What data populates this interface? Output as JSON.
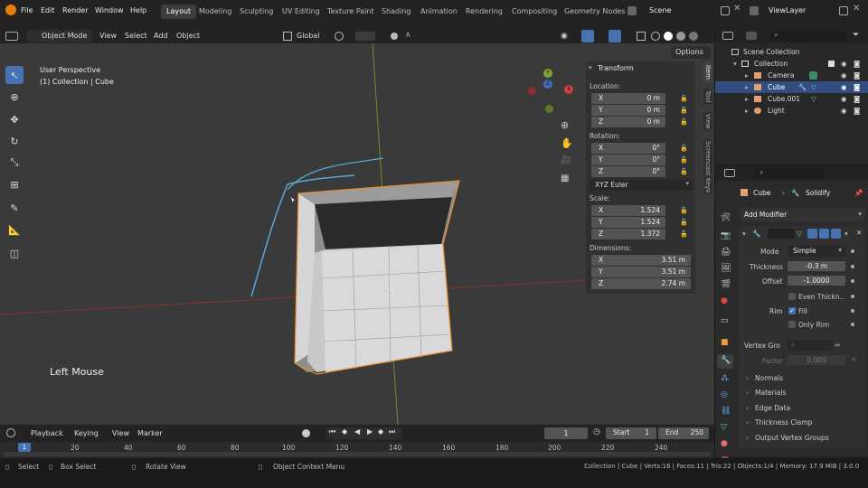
{
  "topbar": {
    "menus": [
      "File",
      "Edit",
      "Render",
      "Window",
      "Help"
    ],
    "workspaces": [
      "Layout",
      "Modeling",
      "Sculpting",
      "UV Editing",
      "Texture Paint",
      "Shading",
      "Animation",
      "Rendering",
      "Compositing",
      "Geometry Nodes"
    ],
    "active_workspace": "Layout",
    "scene_label": "Scene",
    "viewlayer_label": "ViewLayer"
  },
  "viewport_header": {
    "mode": "Object Mode",
    "menus": [
      "View",
      "Select",
      "Add",
      "Object"
    ],
    "orientation": "Global",
    "options_label": "Options"
  },
  "viewport": {
    "perspective": "User Perspective",
    "collection_info": "(1) Collection | Cube",
    "input_hint": "Left Mouse",
    "gizmo_axes": [
      "Y",
      "Z",
      "X"
    ]
  },
  "npanel": {
    "title": "Transform",
    "location_label": "Location:",
    "location": [
      {
        "axis": "X",
        "value": "0 m"
      },
      {
        "axis": "Y",
        "value": "0 m"
      },
      {
        "axis": "Z",
        "value": "0 m"
      }
    ],
    "rotation_label": "Rotation:",
    "rotation": [
      {
        "axis": "X",
        "value": "0°"
      },
      {
        "axis": "Y",
        "value": "0°"
      },
      {
        "axis": "Z",
        "value": "0°"
      }
    ],
    "rotation_mode": "XYZ Euler",
    "scale_label": "Scale:",
    "scale": [
      {
        "axis": "X",
        "value": "1.524"
      },
      {
        "axis": "Y",
        "value": "1.524"
      },
      {
        "axis": "Z",
        "value": "1.372"
      }
    ],
    "dimensions_label": "Dimensions:",
    "dimensions": [
      {
        "axis": "X",
        "value": "3.51 m"
      },
      {
        "axis": "Y",
        "value": "3.51 m"
      },
      {
        "axis": "Z",
        "value": "2.74 m"
      }
    ],
    "tabs": [
      "Item",
      "Tool",
      "View",
      "Screencast Keys"
    ]
  },
  "outliner": {
    "rows": [
      {
        "label": "Scene Collection"
      },
      {
        "label": "Collection"
      },
      {
        "label": "Camera"
      },
      {
        "label": "Cube"
      },
      {
        "label": "Cube.001"
      },
      {
        "label": "Light"
      }
    ]
  },
  "properties": {
    "object_name": "Cube",
    "modifier_name": "Solidify",
    "add_modifier": "Add Modifier",
    "mode_label": "Mode",
    "mode_value": "Simple",
    "thickness_label": "Thickness",
    "thickness_value": "-0.3 m",
    "offset_label": "Offset",
    "offset_value": "-1.0000",
    "even_thickness": "Even Thickn..",
    "rim_label": "Rim",
    "fill_label": "Fill",
    "only_rim_label": "Only Rim",
    "vertex_group_label": "Vertex Gro",
    "factor_label": "Factor",
    "factor_value": "0.000",
    "subpanels": [
      "Normals",
      "Materials",
      "Edge Data",
      "Thickness Clamp",
      "Output Vertex Groups"
    ]
  },
  "timeline": {
    "menus": [
      "Playback",
      "Keying",
      "View",
      "Marker"
    ],
    "current_frame": "1",
    "start_label": "Start",
    "start_value": "1",
    "end_label": "End",
    "end_value": "250",
    "ticks": [
      "20",
      "40",
      "60",
      "80",
      "100",
      "120",
      "140",
      "160",
      "180",
      "200",
      "220",
      "240"
    ],
    "playhead_label": "1"
  },
  "statusbar": {
    "select": "Select",
    "box_select": "Box Select",
    "rotate_view": "Rotate View",
    "context_menu": "Object Context Menu",
    "stats": "Collection | Cube | Verts:16 | Faces:11 | Tris:22 | Objects:1/4 | Memory: 17.9 MiB | 3.0.0"
  },
  "colors": {
    "accent": "#4772b3",
    "selection_outline": "#e8902a",
    "grease_pencil": "#5aa8d8",
    "x_axis": "#b03434",
    "y_axis": "#7da630"
  }
}
